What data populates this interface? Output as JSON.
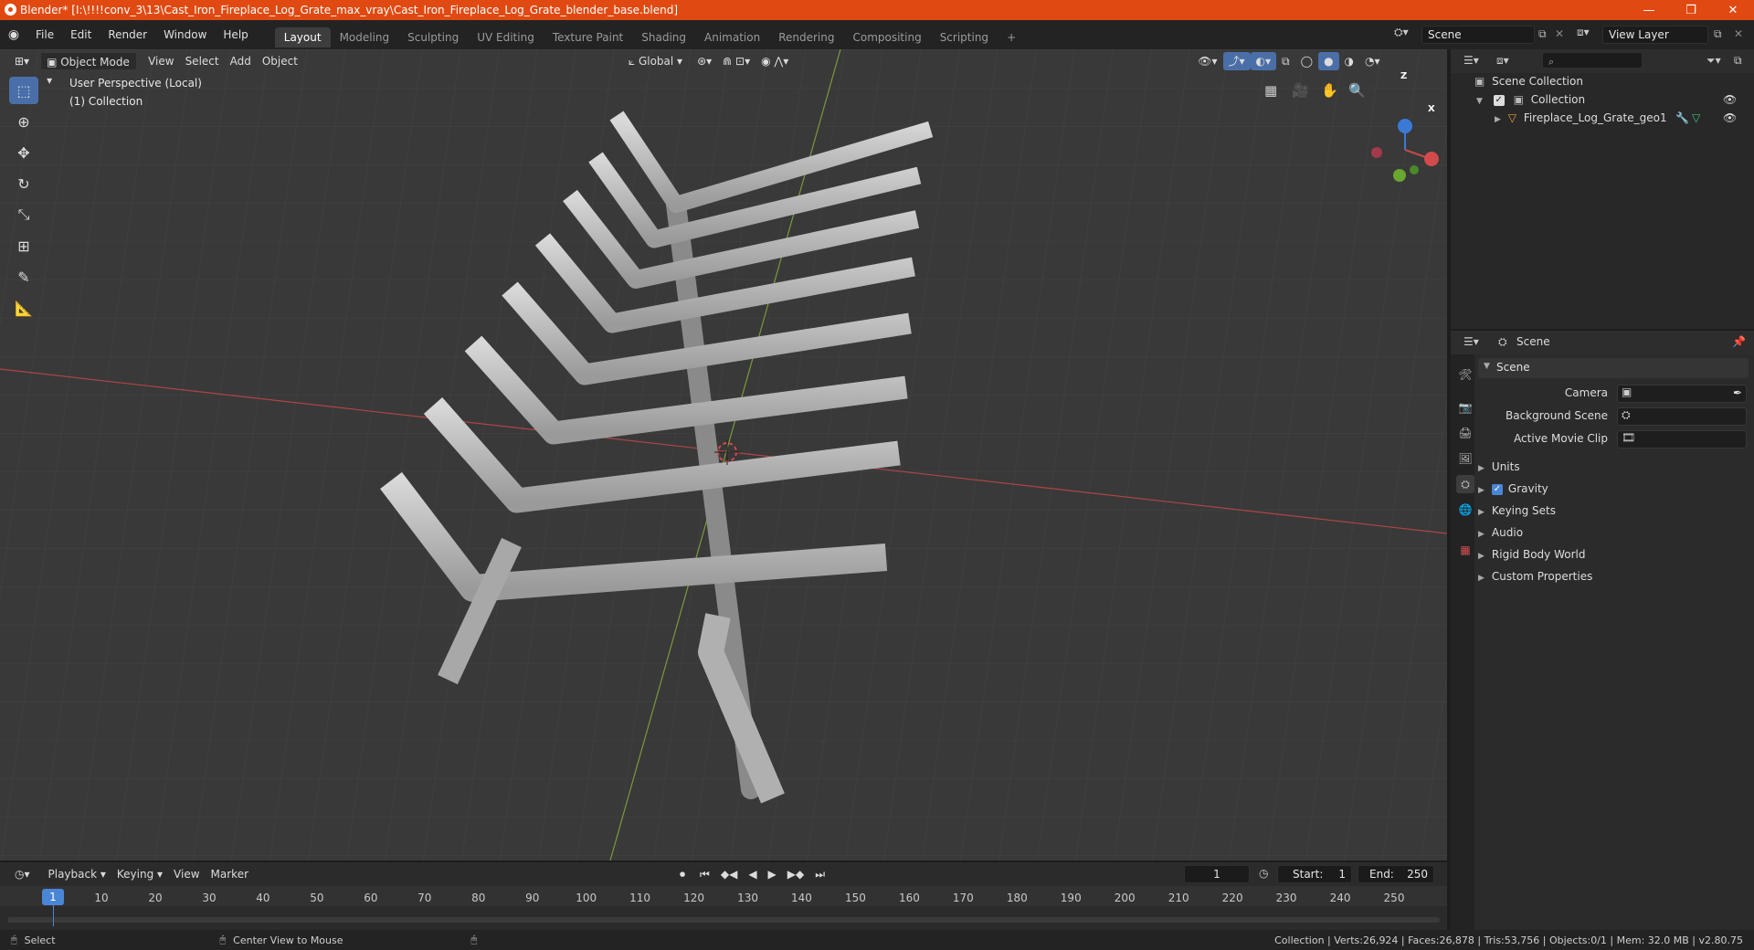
{
  "window": {
    "title": "Blender* [I:\\!!!!conv_3\\13\\Cast_Iron_Fireplace_Log_Grate_max_vray\\Cast_Iron_Fireplace_Log_Grate_blender_base.blend]",
    "minimize": "—",
    "maximize": "❐",
    "close": "✕"
  },
  "menu": {
    "items": [
      "File",
      "Edit",
      "Render",
      "Window",
      "Help"
    ],
    "workspaces": [
      "Layout",
      "Modeling",
      "Sculpting",
      "UV Editing",
      "Texture Paint",
      "Shading",
      "Animation",
      "Rendering",
      "Compositing",
      "Scripting"
    ],
    "add_tab": "+",
    "scene_name": "Scene",
    "view_layer": "View Layer"
  },
  "viewport": {
    "mode": "Object Mode",
    "menus": [
      "View",
      "Select",
      "Add",
      "Object"
    ],
    "orientation": "Global",
    "info_line1": "User Perspective (Local)",
    "info_line2": "(1) Collection",
    "gizmo": {
      "x": "X",
      "y": "Y",
      "z": "Z"
    }
  },
  "outliner": {
    "root": "Scene Collection",
    "collection": "Collection",
    "object": "Fireplace_Log_Grate_geo1"
  },
  "properties": {
    "context": "Scene",
    "section": "Scene",
    "camera_label": "Camera",
    "background_scene_label": "Background Scene",
    "active_movie_clip_label": "Active Movie Clip",
    "panels": [
      "Units",
      "Gravity",
      "Keying Sets",
      "Audio",
      "Rigid Body World",
      "Custom Properties"
    ],
    "gravity_checked": true
  },
  "timeline": {
    "menus": [
      "Playback",
      "Keying",
      "View",
      "Marker"
    ],
    "current_frame": "1",
    "start_label": "Start:",
    "start": "1",
    "end_label": "End:",
    "end": "250",
    "ticks": [
      "1",
      "10",
      "20",
      "30",
      "40",
      "50",
      "60",
      "70",
      "80",
      "90",
      "100",
      "110",
      "120",
      "130",
      "140",
      "150",
      "160",
      "170",
      "180",
      "190",
      "200",
      "210",
      "220",
      "230",
      "240",
      "250"
    ]
  },
  "status": {
    "left1": "Select",
    "left2": "Center View to Mouse",
    "right": "Collection | Verts:26,924 | Faces:26,878 | Tris:53,756 | Objects:0/1 | Mem: 32.0 MB | v2.80.75"
  },
  "colors": {
    "title_bar": "#e04a12",
    "accent": "#4a6fa8",
    "x_axis": "#c44a4a",
    "y_axis": "#7ca03a",
    "z_axis": "#3a7ad6",
    "playhead": "#4a86d6"
  }
}
